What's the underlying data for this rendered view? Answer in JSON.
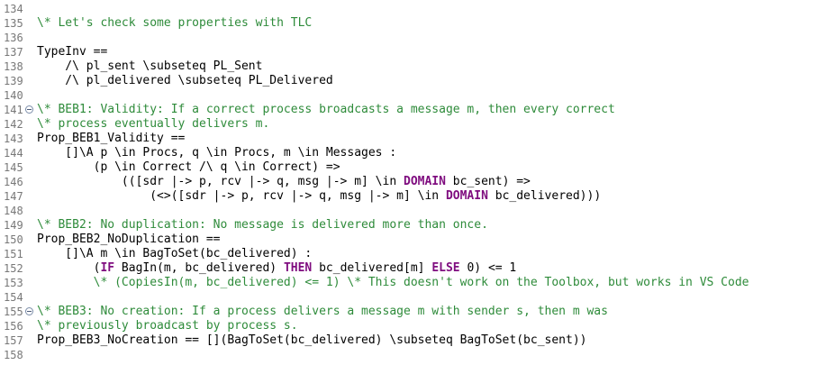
{
  "editor": {
    "lines": [
      {
        "number": "134",
        "fold": false,
        "tokens": []
      },
      {
        "number": "135",
        "fold": false,
        "tokens": [
          {
            "t": "comment",
            "text": "\\* Let's check some properties with TLC"
          }
        ]
      },
      {
        "number": "136",
        "fold": false,
        "tokens": []
      },
      {
        "number": "137",
        "fold": false,
        "tokens": [
          {
            "t": "plain",
            "text": "TypeInv =="
          }
        ]
      },
      {
        "number": "138",
        "fold": false,
        "tokens": [
          {
            "t": "plain",
            "text": "    /\\ pl_sent \\subseteq PL_Sent"
          }
        ]
      },
      {
        "number": "139",
        "fold": false,
        "tokens": [
          {
            "t": "plain",
            "text": "    /\\ pl_delivered \\subseteq PL_Delivered"
          }
        ]
      },
      {
        "number": "140",
        "fold": false,
        "tokens": []
      },
      {
        "number": "141",
        "fold": true,
        "tokens": [
          {
            "t": "comment",
            "text": "\\* BEB1: Validity: If a correct process broadcasts a message m, then every correct"
          }
        ]
      },
      {
        "number": "142",
        "fold": false,
        "tokens": [
          {
            "t": "comment",
            "text": "\\* process eventually delivers m."
          }
        ]
      },
      {
        "number": "143",
        "fold": false,
        "tokens": [
          {
            "t": "plain",
            "text": "Prop_BEB1_Validity =="
          }
        ]
      },
      {
        "number": "144",
        "fold": false,
        "tokens": [
          {
            "t": "plain",
            "text": "    []\\A p \\in Procs, q \\in Procs, m \\in Messages :"
          }
        ]
      },
      {
        "number": "145",
        "fold": false,
        "tokens": [
          {
            "t": "plain",
            "text": "        (p \\in Correct /\\ q \\in Correct) =>"
          }
        ]
      },
      {
        "number": "146",
        "fold": false,
        "tokens": [
          {
            "t": "plain",
            "text": "            (([sdr |-> p, rcv |-> q, msg |-> m] \\in "
          },
          {
            "t": "kw",
            "text": "DOMAIN"
          },
          {
            "t": "plain",
            "text": " bc_sent) =>"
          }
        ]
      },
      {
        "number": "147",
        "fold": false,
        "tokens": [
          {
            "t": "plain",
            "text": "                (<>([sdr |-> p, rcv |-> q, msg |-> m] \\in "
          },
          {
            "t": "kw",
            "text": "DOMAIN"
          },
          {
            "t": "plain",
            "text": " bc_delivered)))"
          }
        ]
      },
      {
        "number": "148",
        "fold": false,
        "tokens": []
      },
      {
        "number": "149",
        "fold": false,
        "tokens": [
          {
            "t": "comment",
            "text": "\\* BEB2: No duplication: No message is delivered more than once."
          }
        ]
      },
      {
        "number": "150",
        "fold": false,
        "tokens": [
          {
            "t": "plain",
            "text": "Prop_BEB2_NoDuplication =="
          }
        ]
      },
      {
        "number": "151",
        "fold": false,
        "tokens": [
          {
            "t": "plain",
            "text": "    []\\A m \\in BagToSet(bc_delivered) :"
          }
        ]
      },
      {
        "number": "152",
        "fold": false,
        "tokens": [
          {
            "t": "plain",
            "text": "        ("
          },
          {
            "t": "kw",
            "text": "IF"
          },
          {
            "t": "plain",
            "text": " BagIn(m, bc_delivered) "
          },
          {
            "t": "kw",
            "text": "THEN"
          },
          {
            "t": "plain",
            "text": " bc_delivered[m] "
          },
          {
            "t": "kw",
            "text": "ELSE"
          },
          {
            "t": "plain",
            "text": " 0) <= 1"
          }
        ]
      },
      {
        "number": "153",
        "fold": false,
        "tokens": [
          {
            "t": "comment",
            "text": "        \\* (CopiesIn(m, bc_delivered) <= 1) \\* This doesn't work on the Toolbox, but works in VS Code"
          }
        ]
      },
      {
        "number": "154",
        "fold": false,
        "tokens": []
      },
      {
        "number": "155",
        "fold": true,
        "tokens": [
          {
            "t": "comment",
            "text": "\\* BEB3: No creation: If a process delivers a message m with sender s, then m was"
          }
        ]
      },
      {
        "number": "156",
        "fold": false,
        "tokens": [
          {
            "t": "comment",
            "text": "\\* previously broadcast by process s."
          }
        ]
      },
      {
        "number": "157",
        "fold": false,
        "tokens": [
          {
            "t": "plain",
            "text": "Prop_BEB3_NoCreation == [](BagToSet(bc_delivered) \\subseteq BagToSet(bc_sent))"
          }
        ]
      },
      {
        "number": "158",
        "fold": false,
        "tokens": []
      }
    ]
  }
}
